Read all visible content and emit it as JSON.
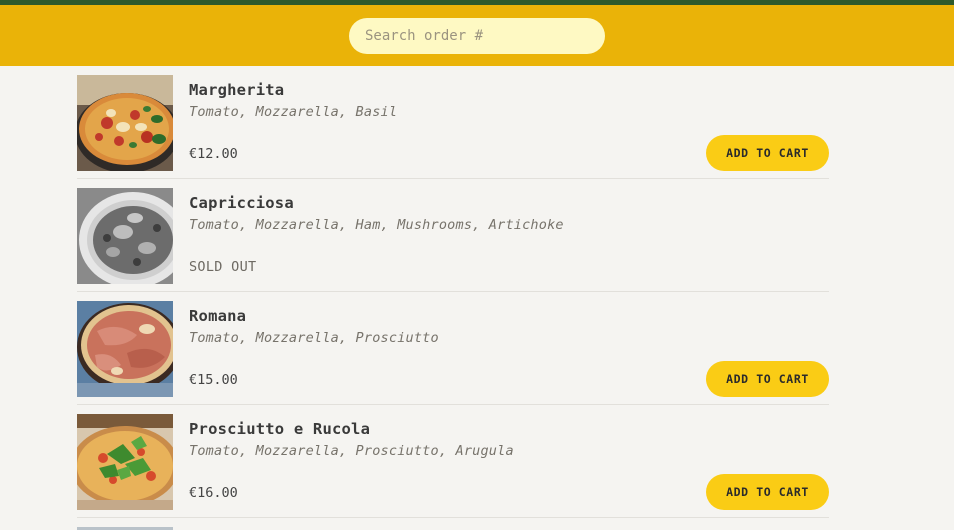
{
  "search": {
    "placeholder": "Search order #"
  },
  "add_label": "ADD TO CART",
  "sold_out_label": "SOLD OUT",
  "items": [
    {
      "name": "Margherita",
      "ingredients": "Tomato, Mozzarella, Basil",
      "price": "€12.00",
      "sold_out": false,
      "image": "pizza-margherita-photo"
    },
    {
      "name": "Capricciosa",
      "ingredients": "Tomato, Mozzarella, Ham, Mushrooms, Artichoke",
      "price": "",
      "sold_out": true,
      "image": "pizza-capricciosa-photo"
    },
    {
      "name": "Romana",
      "ingredients": "Tomato, Mozzarella, Prosciutto",
      "price": "€15.00",
      "sold_out": false,
      "image": "pizza-romana-photo"
    },
    {
      "name": "Prosciutto e Rucola",
      "ingredients": "Tomato, Mozzarella, Prosciutto, Arugula",
      "price": "€16.00",
      "sold_out": false,
      "image": "pizza-prosciutto-rucola-photo"
    }
  ],
  "colors": {
    "topbar": "#2e5a2c",
    "header": "#eab308",
    "search_bg": "#fef9c3",
    "button": "#facc15",
    "background": "#f5f4f1"
  }
}
